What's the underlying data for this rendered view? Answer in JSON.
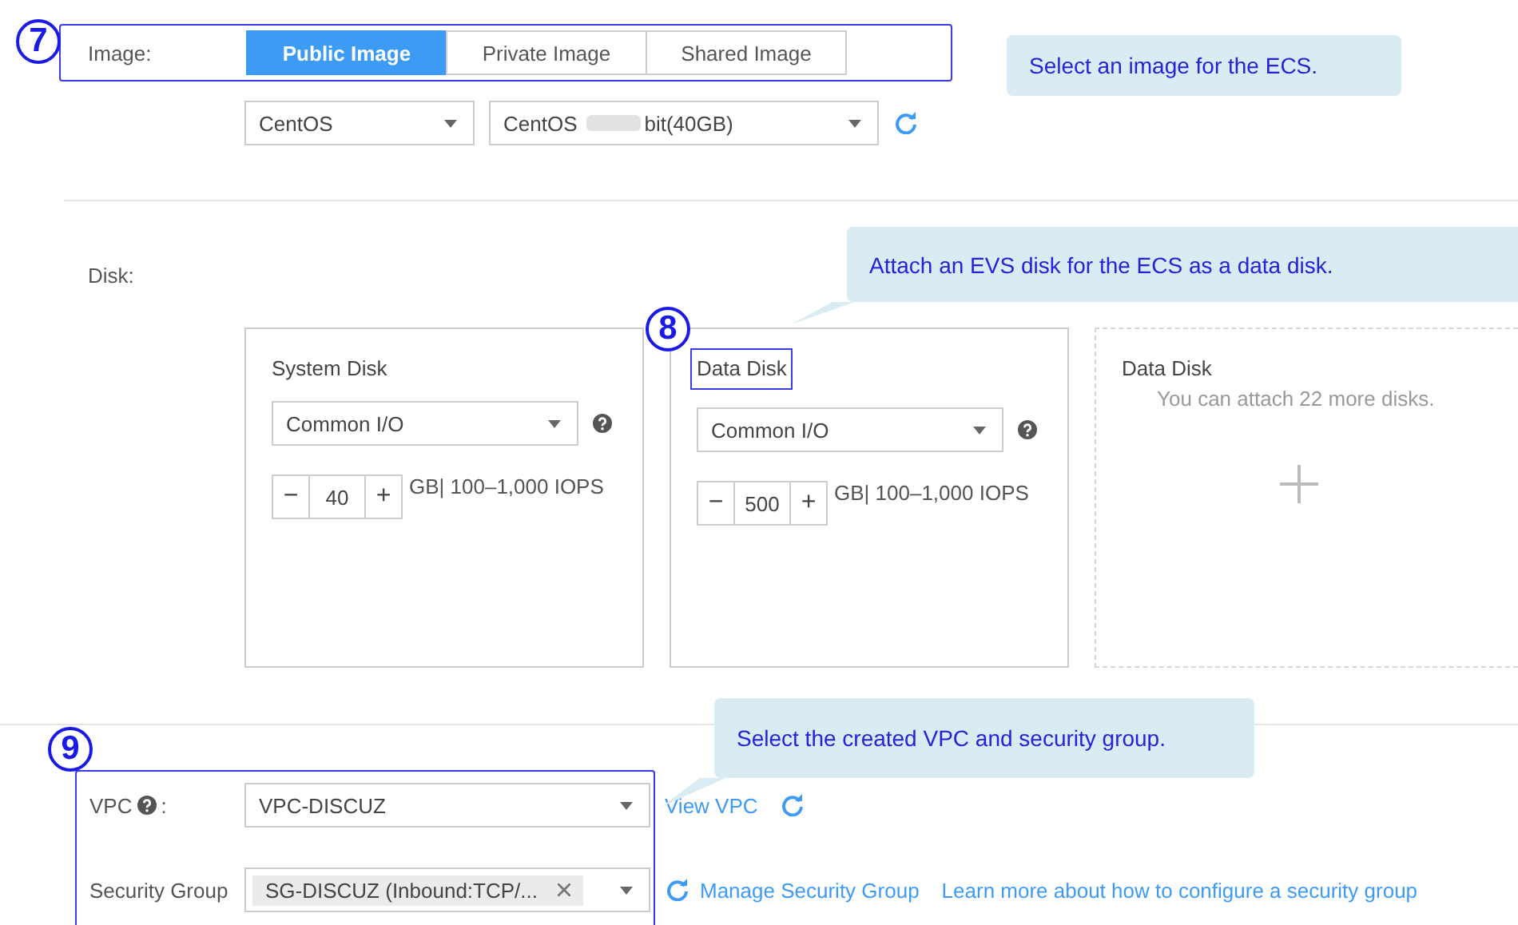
{
  "image_section": {
    "marker": "7",
    "label": "Image:",
    "tabs": [
      {
        "label": "Public Image",
        "selected": true
      },
      {
        "label": "Private Image",
        "selected": false
      },
      {
        "label": "Shared Image",
        "selected": false
      }
    ],
    "os_select": "CentOS",
    "image_select": {
      "prefix": "CentOS",
      "suffix": "bit(40GB)"
    },
    "callout": "Select an image for the ECS."
  },
  "disk_section": {
    "label": "Disk:",
    "marker": "8",
    "callout": "Attach an EVS disk for the ECS as a data disk.",
    "disks": [
      {
        "kind": "disk",
        "title": "System Disk",
        "highlighted": false,
        "type": "Common I/O",
        "decrement": "−",
        "size": "40",
        "increment": "+",
        "performance": "GB| 100–1,000 IOPS"
      },
      {
        "kind": "disk",
        "title": "Data Disk",
        "highlighted": true,
        "type": "Common I/O",
        "decrement": "−",
        "size": "500",
        "increment": "+",
        "performance": "GB| 100–1,000 IOPS"
      },
      {
        "kind": "add",
        "title": "Data Disk",
        "note": "You can attach 22 more disks."
      }
    ]
  },
  "network_section": {
    "marker": "9",
    "callout": "Select the created VPC and security group.",
    "vpc": {
      "label": "VPC",
      "colon": ":",
      "value": "VPC-DISCUZ",
      "link": "View VPC"
    },
    "security_group": {
      "label": "Security Group",
      "tag": "SG-DISCUZ (Inbound:TCP/...",
      "links": [
        "Manage Security Group",
        "Learn more about how to configure a security group"
      ]
    }
  }
}
